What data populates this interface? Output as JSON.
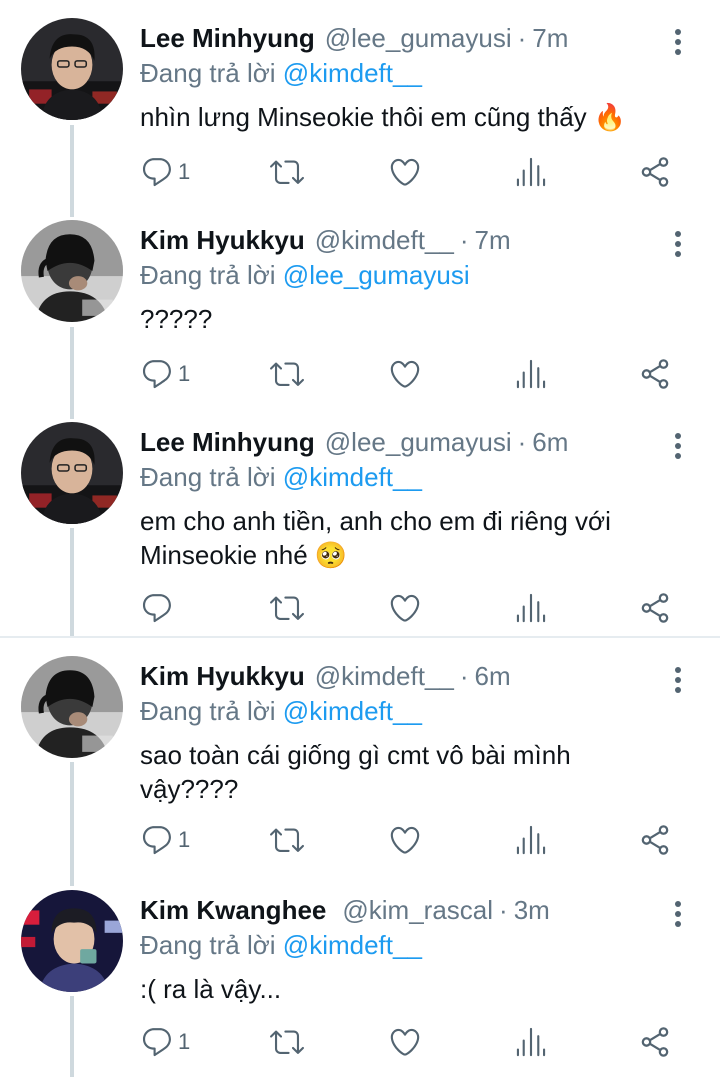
{
  "tweets": [
    {
      "name": "Lee Minhyung",
      "handle": "@lee_gumayusi",
      "time": "7m",
      "reply_prefix": "Đang trả lời",
      "reply_to": "@kimdeft__",
      "text_lines": [
        "nhìn lưng Minseokie thôi em cũng thấy 🔥"
      ],
      "reply_count": "1",
      "avatar": "avatar-lee-minhyung"
    },
    {
      "name": "Kim Hyukkyu",
      "handle": "@kimdeft__",
      "time": "7m",
      "reply_prefix": "Đang trả lời",
      "reply_to": "@lee_gumayusi",
      "text_lines": [
        "?????"
      ],
      "reply_count": "1",
      "avatar": "avatar-kim-hyukkyu"
    },
    {
      "name": "Lee Minhyung",
      "handle": "@lee_gumayusi",
      "time": "6m",
      "reply_prefix": "Đang trả lời",
      "reply_to": "@kimdeft__",
      "text_lines": [
        "em cho anh tiền, anh cho em đi riêng với",
        "Minseokie nhé 🥺"
      ],
      "reply_count": "",
      "avatar": "avatar-lee-minhyung"
    },
    {
      "name": "Kim Hyukkyu",
      "handle": "@kimdeft__",
      "time": "6m",
      "reply_prefix": "Đang trả lời",
      "reply_to": "@kimdeft__",
      "text_lines": [
        "sao toàn cái giống gì cmt vô bài mình",
        "vậy????"
      ],
      "reply_count": "1",
      "avatar": "avatar-kim-hyukkyu"
    },
    {
      "name": "Kim Kwanghee",
      "handle": "@kim_rascal",
      "time": "3m",
      "reply_prefix": "Đang trả lời",
      "reply_to": "@kimdeft__",
      "text_lines": [
        ":( ra là vậy..."
      ],
      "reply_count": "1",
      "avatar": "avatar-kim-kwanghee"
    }
  ],
  "separator": "·",
  "colors": {
    "accent": "#1d9bf0",
    "secondary_text": "#657786",
    "icon": "#536471",
    "thread_line": "#cfd9de",
    "divider": "#e6ecf0"
  },
  "icons": [
    "reply-icon",
    "retweet-icon",
    "like-icon",
    "analytics-icon",
    "share-icon",
    "more-icon"
  ]
}
